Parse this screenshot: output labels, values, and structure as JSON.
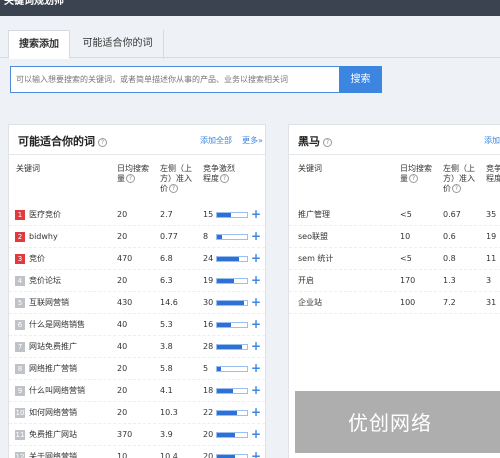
{
  "header": {
    "title": "关键词规划师"
  },
  "tabs": [
    {
      "label": "搜索添加"
    },
    {
      "label": "可能适合你的词"
    }
  ],
  "search": {
    "placeholder": "可以输入想要搜索的关键词，或者简单描述你从事的产品、业务以搜索相关词",
    "button_label": "搜索"
  },
  "left_panel": {
    "title": "可能适合你的词",
    "add_all_label": "添加全部",
    "more_label": "更多»",
    "columns": {
      "keyword": "关键词",
      "daily_l1": "日均搜索",
      "daily_l2": "量",
      "tilt_l1": "左侧（上",
      "tilt_l2": "方）准入",
      "tilt_l3": "价",
      "comp_l1": "竞争激烈",
      "comp_l2": "程度"
    },
    "rows": [
      {
        "rank": "1",
        "keyword": "医疗竞价",
        "daily": "20",
        "price": "2.7",
        "comp": "15",
        "comp_level": 0.45
      },
      {
        "rank": "2",
        "keyword": "bidwhy",
        "daily": "20",
        "price": "0.77",
        "comp": "8",
        "comp_level": 0.18
      },
      {
        "rank": "3",
        "keyword": "竞价",
        "daily": "470",
        "price": "6.8",
        "comp": "24",
        "comp_level": 0.72
      },
      {
        "rank": "4",
        "keyword": "竞价论坛",
        "daily": "20",
        "price": "6.3",
        "comp": "19",
        "comp_level": 0.58
      },
      {
        "rank": "5",
        "keyword": "互联网营销",
        "daily": "430",
        "price": "14.6",
        "comp": "30",
        "comp_level": 0.9
      },
      {
        "rank": "6",
        "keyword": "什么是网络销售",
        "daily": "40",
        "price": "5.3",
        "comp": "16",
        "comp_level": 0.48
      },
      {
        "rank": "7",
        "keyword": "网站免费推广",
        "daily": "40",
        "price": "3.8",
        "comp": "28",
        "comp_level": 0.84
      },
      {
        "rank": "8",
        "keyword": "网络推广营销",
        "daily": "20",
        "price": "5.8",
        "comp": "5",
        "comp_level": 0.14
      },
      {
        "rank": "9",
        "keyword": "什么叫网络营销",
        "daily": "20",
        "price": "4.1",
        "comp": "18",
        "comp_level": 0.54
      },
      {
        "rank": "10",
        "keyword": "如何网络营销",
        "daily": "20",
        "price": "10.3",
        "comp": "22",
        "comp_level": 0.66
      },
      {
        "rank": "11",
        "keyword": "免费推广网站",
        "daily": "370",
        "price": "3.9",
        "comp": "20",
        "comp_level": 0.6
      },
      {
        "rank": "12",
        "keyword": "关于网络营销",
        "daily": "10",
        "price": "10.4",
        "comp": "20",
        "comp_level": 0.6
      }
    ]
  },
  "right_panel": {
    "title": "黑马",
    "add_label": "添加",
    "columns": {
      "keyword": "关键词",
      "daily_l1": "日均搜索",
      "daily_l2": "量",
      "tilt_l1": "左侧（上",
      "tilt_l2": "方）准入",
      "tilt_l3": "价",
      "comp_l1": "竞争",
      "comp_l2": "程度"
    },
    "rows": [
      {
        "keyword": "推广管理",
        "daily": "<5",
        "price": "0.67",
        "comp": "35"
      },
      {
        "keyword": "seo联盟",
        "daily": "10",
        "price": "0.6",
        "comp": "19"
      },
      {
        "keyword": "sem 统计",
        "daily": "<5",
        "price": "0.8",
        "comp": "11"
      },
      {
        "keyword": "开启",
        "daily": "170",
        "price": "1.3",
        "comp": "3"
      },
      {
        "keyword": "企业站",
        "daily": "100",
        "price": "7.2",
        "comp": "31"
      }
    ]
  },
  "watermark": {
    "text": "优创网络"
  },
  "colors": {
    "accent": "#3c85e0",
    "rank_top": "#e0393e",
    "rank_other": "#bfc3c8",
    "bar_fill": "#2f6fd8"
  }
}
